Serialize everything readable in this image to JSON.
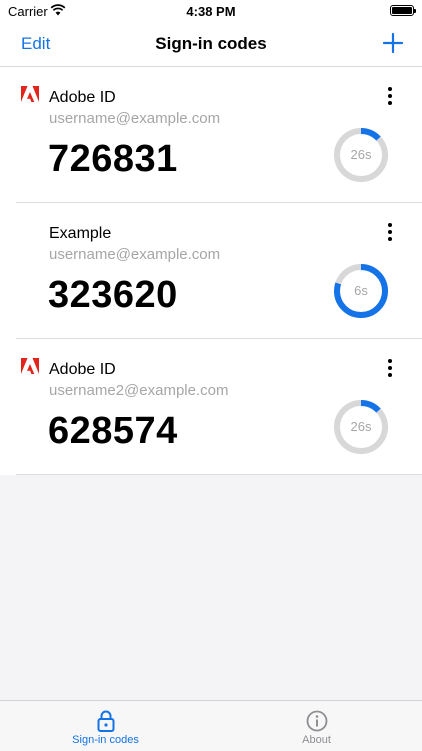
{
  "status_bar": {
    "carrier": "Carrier",
    "time": "4:38 PM"
  },
  "nav": {
    "edit_label": "Edit",
    "title": "Sign-in codes",
    "add_icon": "plus-icon"
  },
  "accounts": [
    {
      "logo": "adobe-logo",
      "name": "Adobe ID",
      "email": "username@example.com",
      "code": "726831",
      "timer_label": "26s",
      "timer_progress": 0.13,
      "timer_color": "#1473e6"
    },
    {
      "logo": "",
      "name": "Example",
      "email": "username@example.com",
      "code": "323620",
      "timer_label": "6s",
      "timer_progress": 0.8,
      "timer_color": "#1473e6"
    },
    {
      "logo": "adobe-logo",
      "name": "Adobe ID",
      "email": "username2@example.com",
      "code": "628574",
      "timer_label": "26s",
      "timer_progress": 0.13,
      "timer_color": "#1473e6"
    }
  ],
  "tabs": [
    {
      "label": "Sign-in codes",
      "icon": "lock-icon",
      "active": true
    },
    {
      "label": "About",
      "icon": "info-icon",
      "active": false
    }
  ],
  "colors": {
    "accent": "#1473e6",
    "adobe_red": "#e1251b",
    "timer_track": "#d8d8d8",
    "secondary_text": "#a6a6a6"
  }
}
